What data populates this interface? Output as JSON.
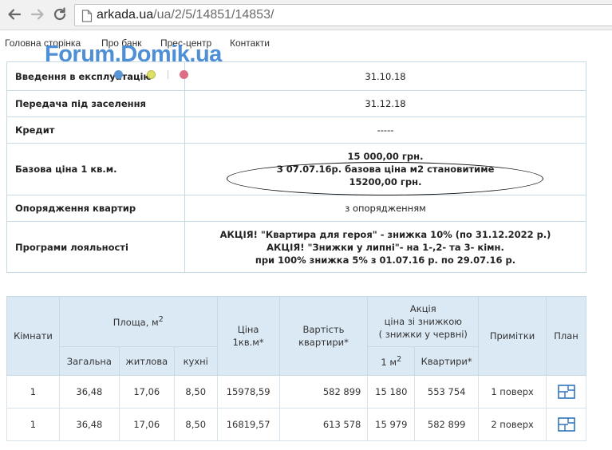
{
  "browser": {
    "url_domain": "arkada.ua",
    "url_path": "/ua/2/5/14851/14853/"
  },
  "site_menu": {
    "items": [
      "Головна сторінка",
      "Про банк",
      "Прес-центр",
      "Контакти"
    ]
  },
  "watermark": "Forum.Domik.ua",
  "colors": {
    "dot_blue": "#5b95d6",
    "dot_yellow": "#e0df66",
    "dot_pink": "#dc6f86",
    "header_bg": "#dbe9f5",
    "icon_blue": "#2f74c0"
  },
  "info": {
    "commissioning": {
      "label": "Введення в експлуатацію",
      "value": "31.10.18"
    },
    "handover": {
      "label": "Передача під заселення",
      "value": "31.12.18"
    },
    "credit": {
      "label": "Кредит",
      "value": "-----"
    },
    "base_price": {
      "label": "Базова ціна 1 кв.м.",
      "line1": "15 000,00 грн.",
      "line2": "З 07.07.16р. базова ціна м2 становитиме",
      "line3": "15200,00 грн."
    },
    "finishing": {
      "label": "Опорядження квартир",
      "value": "з опорядженням"
    },
    "loyalty": {
      "label": "Програми лояльності",
      "line1": "АКЦІЯ! \"Квартира для героя\" - знижка 10% (по 31.12.2022 р.)",
      "line2": "АКЦІЯ! \"Знижки у липні\"- на 1-,2- та 3- кімн.",
      "line3": "при 100% знижка 5% з 01.07.16 р. по 29.07.16 р."
    }
  },
  "apartments": {
    "headers": {
      "rooms": "Кімнати",
      "area": "Площа, м",
      "area_sup": "2",
      "price_line1": "Ціна",
      "price_line2": "1кв.м*",
      "cost_line1": "Вартість",
      "cost_line2": "квартири*",
      "promo_line1": "Акція",
      "promo_line2": "ціна зі знижкою",
      "promo_line3": "( знижки у червні)",
      "notes": "Примітки",
      "plan": "План",
      "total": "Загальна",
      "living": "житлова",
      "kitchen": "кухні",
      "promo_m2": "1 м",
      "promo_m2_sup": "2",
      "promo_apartment": "Квартири*"
    },
    "rows": [
      {
        "rooms": "1",
        "total": "36,48",
        "living": "17,06",
        "kitchen": "8,50",
        "price": "15978,59",
        "cost": "582 899",
        "promo_m2": "15 180",
        "promo_apartment": "553 754",
        "notes": "1 поверх",
        "plan_icon": "floor-plan-icon"
      },
      {
        "rooms": "1",
        "total": "36,48",
        "living": "17,06",
        "kitchen": "8,50",
        "price": "16819,57",
        "cost": "613 578",
        "promo_m2": "15 979",
        "promo_apartment": "582 899",
        "notes": "2 поверх",
        "plan_icon": "floor-plan-icon"
      }
    ]
  }
}
